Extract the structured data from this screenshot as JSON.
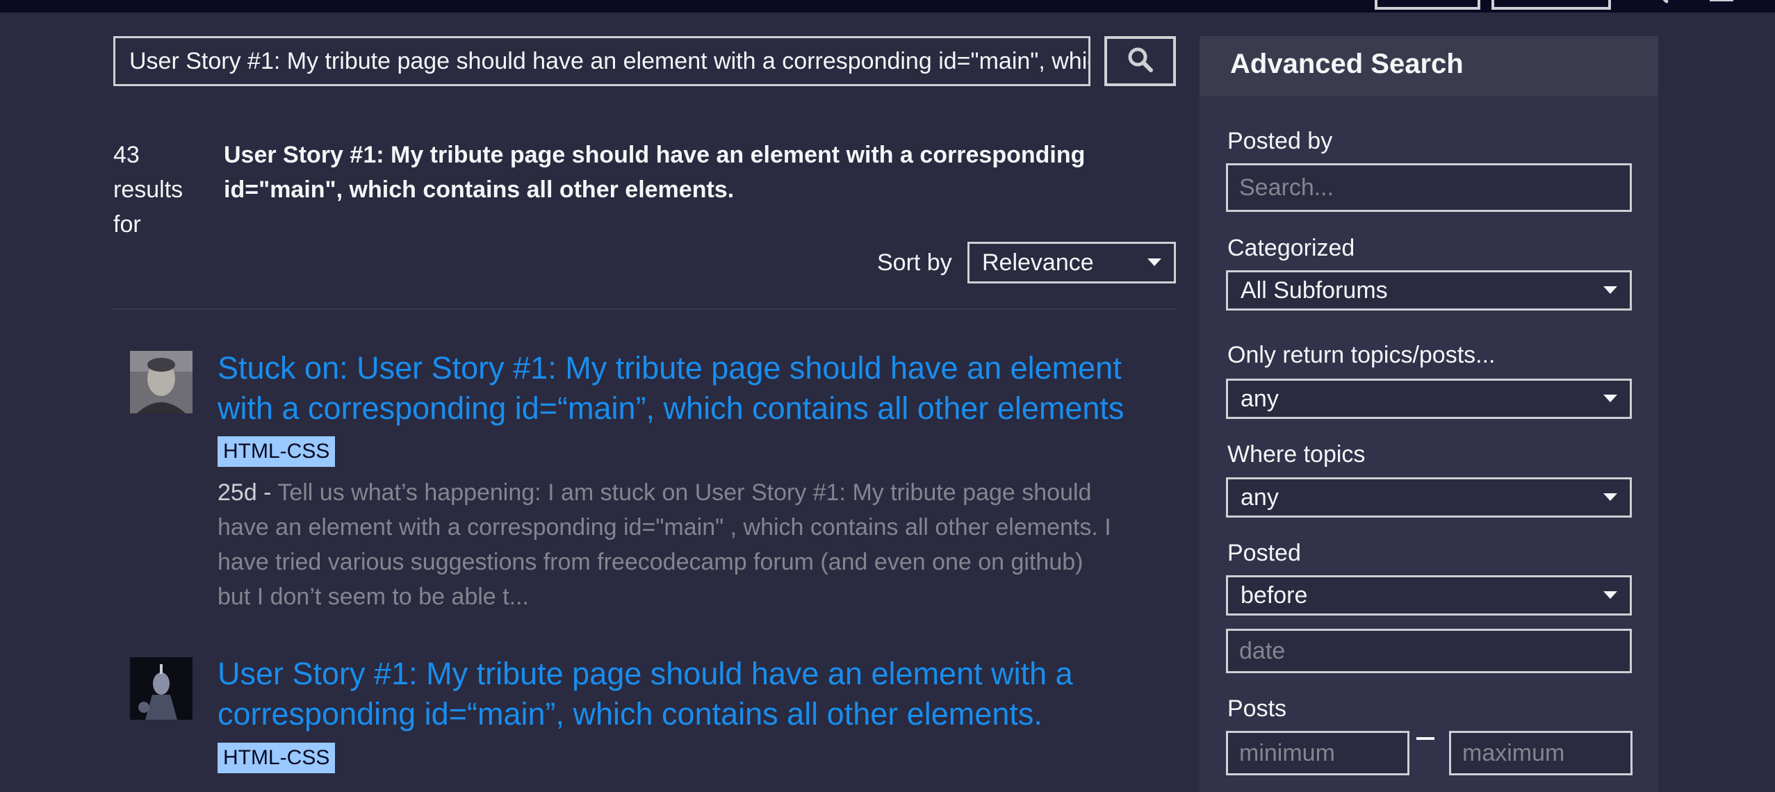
{
  "search": {
    "query": "User Story #1: My tribute page should have an element with a corresponding id=\"main\", which contains all other elements."
  },
  "results_header": {
    "count_line1": "43",
    "count_line2": "results",
    "count_line3": "for",
    "query": "User Story #1: My tribute page should have an element with a corresponding id=\"main\", which contains all other elements.",
    "sort_label": "Sort by",
    "sort_value": "Relevance"
  },
  "results": [
    {
      "title": "Stuck on: User Story #1: My tribute page should have an element with a corresponding id=“main”, which contains all other elements",
      "tag": "HTML-CSS",
      "date": "25d - ",
      "blurb": "Tell us what’s happening: I am stuck on User Story #1: My tribute page should have an element with a corresponding id=\"main\" , which contains all other elements. I have tried various suggestions from freecodecamp forum (and even one on github) but I don’t seem to be able t..."
    },
    {
      "title": "User Story #1: My tribute page should have an element with a corresponding id=“main”, which contains all other elements.",
      "tag": "HTML-CSS"
    }
  ],
  "advanced": {
    "title": "Advanced Search",
    "posted_by_label": "Posted by",
    "posted_by_placeholder": "Search...",
    "categorized_label": "Categorized",
    "categorized_value": "All Subforums",
    "only_return_label": "Only return topics/posts...",
    "only_return_value": "any",
    "where_topics_label": "Where topics",
    "where_topics_value": "any",
    "posted_label": "Posted",
    "posted_value": "before",
    "date_placeholder": "date",
    "posts_label": "Posts",
    "min_placeholder": "minimum",
    "max_placeholder": "maximum"
  },
  "colors": {
    "background": "#2a2a40",
    "link": "#198eee",
    "tag_bg": "#99c9ff",
    "muted_text": "#858591"
  },
  "icons": [
    "search-icon",
    "user-icon",
    "menu-icon",
    "chevron-down-icon"
  ]
}
